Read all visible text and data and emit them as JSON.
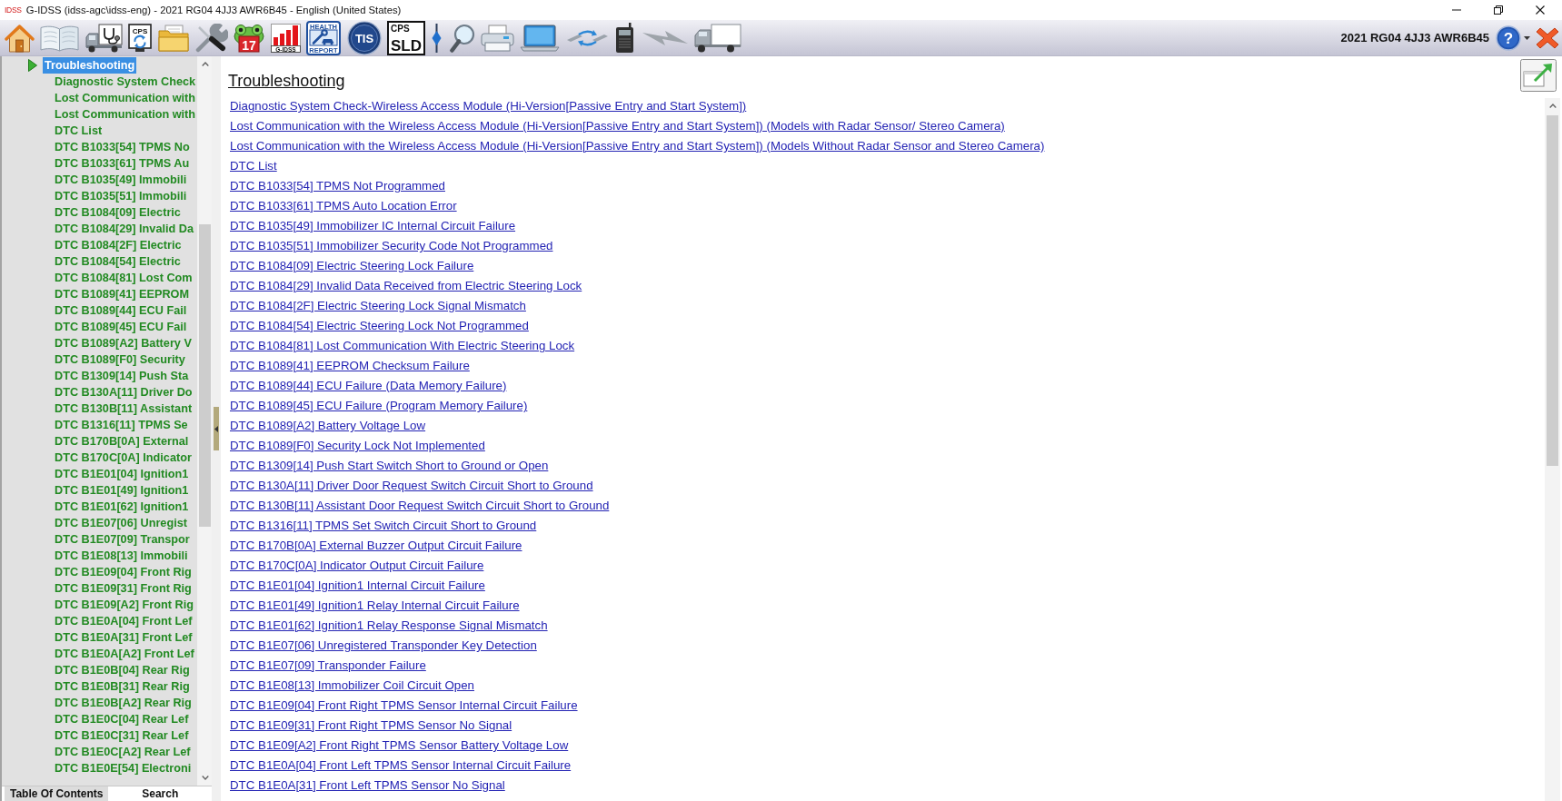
{
  "window": {
    "app_logo": "IDSS",
    "title": "G-IDSS (idss-agc\\idss-eng) - 2021 RG04 4JJ3 AWR6B45 - English (United States)"
  },
  "toolbar": {
    "buttons": [
      {
        "kind": "home"
      },
      {
        "kind": "manual"
      },
      {
        "kind": "diagnosis"
      },
      {
        "kind": "monitor",
        "label": "CPS"
      },
      {
        "kind": "folder"
      },
      {
        "kind": "tools"
      },
      {
        "kind": "frog",
        "label": "17"
      },
      {
        "kind": "chart",
        "label": "G-IDSS"
      },
      {
        "kind": "report",
        "label_top": "HEALTH",
        "label_bottom": "REPORT"
      },
      {
        "kind": "disc",
        "label": "TIS"
      },
      {
        "kind": "tile",
        "label_top": "CPS",
        "label_bottom": "SLD"
      },
      {
        "kind": "divider"
      },
      {
        "kind": "search"
      },
      {
        "kind": "printer"
      },
      {
        "kind": "laptop"
      },
      {
        "kind": "exchange"
      },
      {
        "kind": "device"
      },
      {
        "kind": "lightning"
      },
      {
        "kind": "truck"
      }
    ],
    "vehicle": "2021 RG04 4JJ3 AWR6B45",
    "help": "?"
  },
  "sidebar": {
    "tree": [
      {
        "label": "Troubleshooting",
        "selected": true,
        "children": [
          {
            "label": "Diagnostic System Check",
            "selected": false
          },
          {
            "label": "Lost Communication with",
            "selected": false
          },
          {
            "label": "Lost Communication with",
            "selected": false
          },
          {
            "label": "DTC List",
            "selected": false
          },
          {
            "label": "DTC B1033[54] TPMS No",
            "selected": false
          },
          {
            "label": "DTC B1033[61] TPMS Au",
            "selected": false
          },
          {
            "label": "DTC B1035[49] Immobili",
            "selected": false
          },
          {
            "label": "DTC B1035[51] Immobili",
            "selected": false
          },
          {
            "label": "DTC B1084[09] Electric",
            "selected": false
          },
          {
            "label": "DTC B1084[29] Invalid Da",
            "selected": false
          },
          {
            "label": "DTC B1084[2F] Electric",
            "selected": false
          },
          {
            "label": "DTC B1084[54] Electric",
            "selected": false
          },
          {
            "label": "DTC B1084[81] Lost Com",
            "selected": false
          },
          {
            "label": "DTC B1089[41] EEPROM",
            "selected": false
          },
          {
            "label": "DTC B1089[44] ECU Fail",
            "selected": false
          },
          {
            "label": "DTC B1089[45] ECU Fail",
            "selected": false
          },
          {
            "label": "DTC B1089[A2] Battery V",
            "selected": false
          },
          {
            "label": "DTC B1089[F0] Security",
            "selected": false
          },
          {
            "label": "DTC B1309[14] Push Sta",
            "selected": false
          },
          {
            "label": "DTC B130A[11] Driver Do",
            "selected": false
          },
          {
            "label": "DTC B130B[11] Assistant",
            "selected": false
          },
          {
            "label": "DTC B1316[11] TPMS Se",
            "selected": false
          },
          {
            "label": "DTC B170B[0A] External",
            "selected": false
          },
          {
            "label": "DTC B170C[0A] Indicator",
            "selected": false
          },
          {
            "label": "DTC B1E01[04] Ignition1",
            "selected": false
          },
          {
            "label": "DTC B1E01[49] Ignition1",
            "selected": false
          },
          {
            "label": "DTC B1E01[62] Ignition1",
            "selected": false
          },
          {
            "label": "DTC B1E07[06] Unregist",
            "selected": false
          },
          {
            "label": "DTC B1E07[09] Transpor",
            "selected": false
          },
          {
            "label": "DTC B1E08[13] Immobili",
            "selected": false
          },
          {
            "label": "DTC B1E09[04] Front Rig",
            "selected": false
          },
          {
            "label": "DTC B1E09[31] Front Rig",
            "selected": false
          },
          {
            "label": "DTC B1E09[A2] Front Rig",
            "selected": false
          },
          {
            "label": "DTC B1E0A[04] Front Lef",
            "selected": false
          },
          {
            "label": "DTC B1E0A[31] Front Lef",
            "selected": false
          },
          {
            "label": "DTC B1E0A[A2] Front Lef",
            "selected": false
          },
          {
            "label": "DTC B1E0B[04] Rear Rig",
            "selected": false
          },
          {
            "label": "DTC B1E0B[31] Rear Rig",
            "selected": false
          },
          {
            "label": "DTC B1E0B[A2] Rear Rig",
            "selected": false
          },
          {
            "label": "DTC B1E0C[04] Rear Lef",
            "selected": false
          },
          {
            "label": "DTC B1E0C[31] Rear Lef",
            "selected": false
          },
          {
            "label": "DTC B1E0C[A2] Rear Lef",
            "selected": false
          },
          {
            "label": "DTC B1E0E[54] Electroni",
            "selected": false
          }
        ]
      }
    ],
    "tabs": [
      {
        "label": "Table Of Contents",
        "selected": true
      },
      {
        "label": "Search",
        "selected": false
      }
    ]
  },
  "document": {
    "heading": "Troubleshooting",
    "links": [
      "Diagnostic System Check-Wireless Access Module (Hi-Version[Passive Entry and Start System])",
      "Lost Communication with the Wireless Access Module (Hi-Version[Passive Entry and Start System]) (Models with Radar Sensor/ Stereo Camera)",
      "Lost Communication with the Wireless Access Module (Hi-Version[Passive Entry and Start System]) (Models Without Radar Sensor and Stereo Camera)",
      "DTC List",
      "DTC B1033[54] TPMS Not Programmed",
      "DTC B1033[61] TPMS Auto Location Error",
      "DTC B1035[49] Immobilizer IC Internal Circuit Failure",
      "DTC B1035[51] Immobilizer Security Code Not Programmed",
      "DTC B1084[09] Electric Steering Lock Failure",
      "DTC B1084[29] Invalid Data Received from Electric Steering Lock",
      "DTC B1084[2F] Electric Steering Lock Signal Mismatch",
      "DTC B1084[54] Electric Steering Lock Not Programmed",
      "DTC B1084[81] Lost Communication With Electric Steering Lock",
      "DTC B1089[41] EEPROM Checksum Failure",
      "DTC B1089[44] ECU Failure (Data Memory Failure)",
      "DTC B1089[45] ECU Failure (Program Memory Failure)",
      "DTC B1089[A2] Battery Voltage Low",
      "DTC B1089[F0] Security Lock Not Implemented",
      "DTC B1309[14] Push Start Switch Short to Ground or Open",
      "DTC B130A[11] Driver Door Request Switch Circuit Short to Ground",
      "DTC B130B[11] Assistant Door Request Switch Circuit Short to Ground",
      "DTC B1316[11] TPMS Set Switch Circuit Short to Ground",
      "DTC B170B[0A] External Buzzer Output Circuit Failure",
      "DTC B170C[0A] Indicator Output Circuit Failure",
      "DTC B1E01[04] Ignition1 Internal Circuit Failure",
      "DTC B1E01[49] Ignition1 Relay Internal Circuit Failure",
      "DTC B1E01[62] Ignition1 Relay Response Signal Mismatch",
      "DTC B1E07[06] Unregistered Transponder Key Detection",
      "DTC B1E07[09] Transponder Failure",
      "DTC B1E08[13] Immobilizer Coil Circuit Open",
      "DTC B1E09[04] Front Right TPMS Sensor Internal Circuit Failure",
      "DTC B1E09[31] Front Right TPMS Sensor No Signal",
      "DTC B1E09[A2] Front Right TPMS Sensor Battery Voltage Low",
      "DTC B1E0A[04] Front Left TPMS Sensor Internal Circuit Failure",
      "DTC B1E0A[31] Front Left TPMS Sensor No Signal"
    ]
  }
}
